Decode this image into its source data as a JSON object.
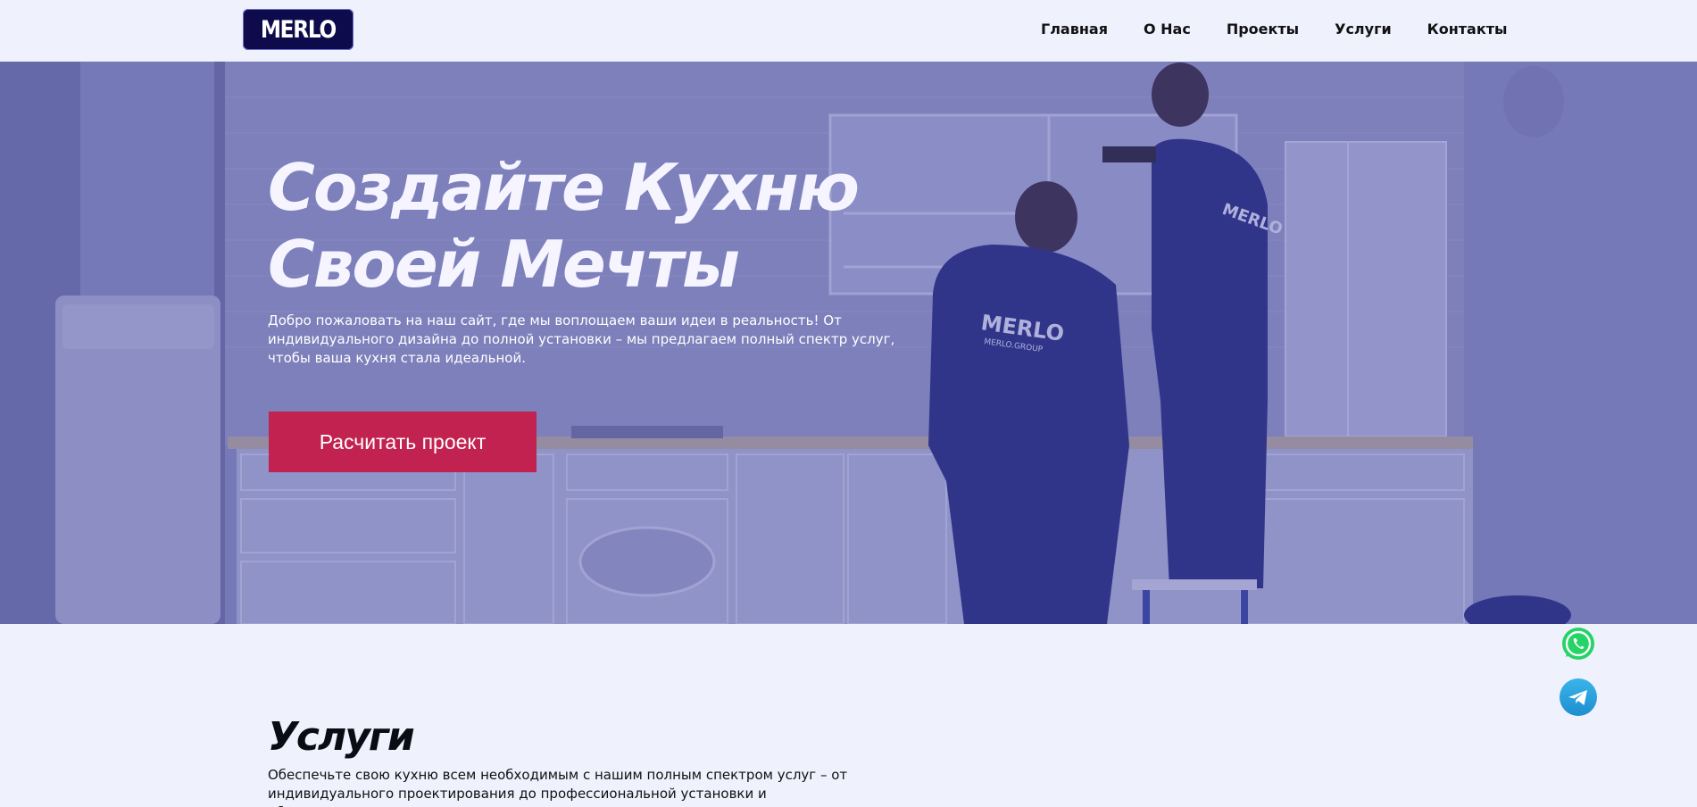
{
  "header": {
    "logo_text": "MERLO",
    "nav": [
      {
        "label": "Главная"
      },
      {
        "label": "О Нас"
      },
      {
        "label": "Проекты"
      },
      {
        "label": "Услуги"
      },
      {
        "label": "Контакты"
      }
    ]
  },
  "hero": {
    "title_line1": "Создайте Кухню",
    "title_line2": "Своей Мечты",
    "text": "Добро пожаловать на наш сайт, где мы воплощаем ваши идеи в реальность! От индивидуального дизайна до полной установки – мы предлагаем полный спектр услуг, чтобы ваша кухня стала идеальной.",
    "cta_label": "Расчитать проект",
    "photo_text_1": "MERLO",
    "photo_text_2": "MERLO.GROUP"
  },
  "services": {
    "title": "Услуги",
    "text": "Обеспечьте свою кухню всем необходимым с нашим полным спектром услуг – от индивидуального проектирования до профессиональной установки и обслуживания"
  },
  "colors": {
    "accent": "#c2224f",
    "logo_bg": "#0d0b4b",
    "page_bg": "#eff1fd",
    "whatsapp": "#25d366",
    "telegram": "#2aa3df"
  },
  "icons": {
    "whatsapp": "whatsapp-icon",
    "telegram": "telegram-icon"
  }
}
